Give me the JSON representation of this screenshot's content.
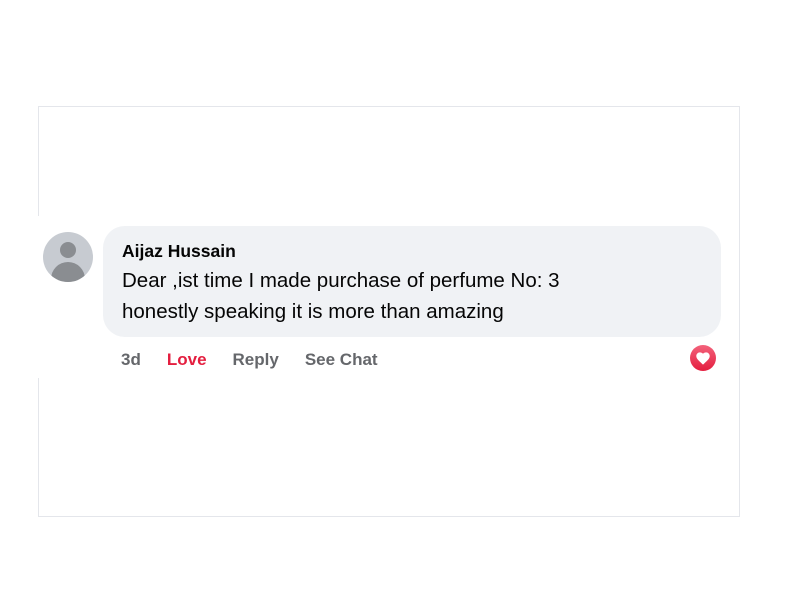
{
  "comment": {
    "author": "Aijaz Hussain",
    "text": "Dear ,ist time I made purchase of perfume No: 3\nhonestly speaking it is more than amazing",
    "actions": {
      "time": "3d",
      "reaction": "Love",
      "reply": "Reply",
      "see_chat": "See Chat"
    },
    "reaction_icon": "heart-icon",
    "avatar_icon": "default-avatar-icon"
  },
  "colors": {
    "bubble": "#f0f2f5",
    "love": "#e41e3f",
    "muted": "#65676b",
    "text": "#050505"
  }
}
